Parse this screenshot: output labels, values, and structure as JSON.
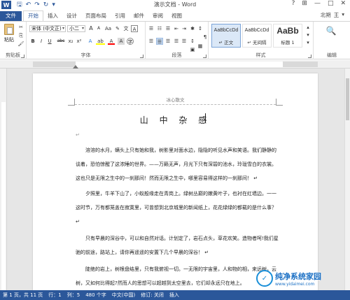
{
  "title": {
    "doc_title": "演示文档 - Word",
    "minimize": "—",
    "restore": "□",
    "close": "✕",
    "help": "?",
    "ribbon_opts": "⊞"
  },
  "qat": {
    "word_badge": "W",
    "save": "🖫",
    "undo": "↶",
    "redo": "↷",
    "repeat": "↻",
    "customize": "▾"
  },
  "tabs": [
    "文件",
    "开始",
    "插入",
    "设计",
    "页面布局",
    "引用",
    "邮件",
    "审阅",
    "视图"
  ],
  "active_tab": "开始",
  "user": {
    "name": "北朔",
    "sep": "王",
    "chevron": "▾"
  },
  "ribbon": {
    "clipboard": {
      "label": "剪贴板",
      "paste": "粘贴",
      "cut": "✂",
      "copy": "⎘",
      "format_painter": "🖌"
    },
    "font": {
      "label": "字体",
      "font_name": "宋体 (中文正)",
      "font_size": "小二",
      "grow": "A",
      "shrink": "A",
      "case": "Aa",
      "clear": "✎",
      "phonetic": "文",
      "border_char": "A",
      "bold": "B",
      "italic": "I",
      "underline": "U",
      "strike": "abc",
      "subscript": "x₂",
      "superscript": "x²",
      "effects": "A",
      "highlight": "ab",
      "color": "A",
      "shading": "A",
      "enclose": "字"
    },
    "paragraph": {
      "label": "段落",
      "bullets": "☰",
      "numbering": "☷",
      "multilevel": "☰",
      "decrease_indent": "⇤",
      "increase_indent": "⇥",
      "chinese_layout": "✱",
      "sort": "↕",
      "show_marks": "¶",
      "align_left": "☰",
      "align_center": "☰",
      "align_right": "☰",
      "justify": "☰",
      "distributed": "☰",
      "line_spacing": "↕",
      "shading": "▦",
      "borders": "▣"
    },
    "styles": {
      "label": "样式",
      "items": [
        {
          "sample": "AaBbCcDd",
          "name": "↵ 正文"
        },
        {
          "sample": "AaBbCcDd",
          "name": "↵ 无间隔"
        },
        {
          "sample": "AaBb",
          "name": "标题 1"
        }
      ],
      "scroll_up": "▴",
      "scroll_down": "▾",
      "more": "▾"
    },
    "editing": {
      "label": "编辑",
      "find": "🔍"
    }
  },
  "document": {
    "header_text": "冰心散文",
    "heading": "山 中 杂 感",
    "paragraphs": [
      "↵",
      "溶溶的水月，螨头上只有她和我，树影里对面水边，隐隐的听见水声和笑语。我们静静的谈着，恐怕惊醒了这浓睡的世界。——万籁无声，月光下只有深碧的池水，玲珑雪白的衣裳。这也只是无限之生中的一刹那间！然而无限之生中，哪里容易得这样的一刹那间！ ↵",
      "夕照里，牛羊下山了，小蚁般缘走在青岗上。绿树丛巅的嫩黄叶子，也衬在红墙边。一一这时节，万有都笼盖在寂寞里，可曾想到北京城里的新闻纸上，花花绿绿的都载的是什么事？ ↵",
      "只有早晨的深谷中，可以和自然对话。计划定了，岩石点头，草花欢笑。造物者呵!我们星驰的前途，路站上，请你再遥遥的安置下几个早晨的深谷！ ↵",
      "陡绝的岩上，树根盘结里，只有我俯视一切。一无限的宇宙里，人和物的相，来远树，云树，又如何比得起?然而人的思想可以超越到太空里去，它们却永远只在地上。"
    ]
  },
  "status": {
    "page": "第 1 页，共 11 页",
    "line": "行：1",
    "col": "列：5",
    "words": "480 个字",
    "lang": "中文(中国)",
    "macro": "插入",
    "track": "修订: 关闭",
    "mode": "插入"
  },
  "watermark": {
    "logo": "✓",
    "line1": "纯净系统家园",
    "line2": "www.yidaimei.com"
  },
  "colors": {
    "brand": "#2b579a",
    "statusbar": "#2b579a",
    "font_color_red": "#ff0000",
    "highlight_yellow": "#ffff00"
  }
}
